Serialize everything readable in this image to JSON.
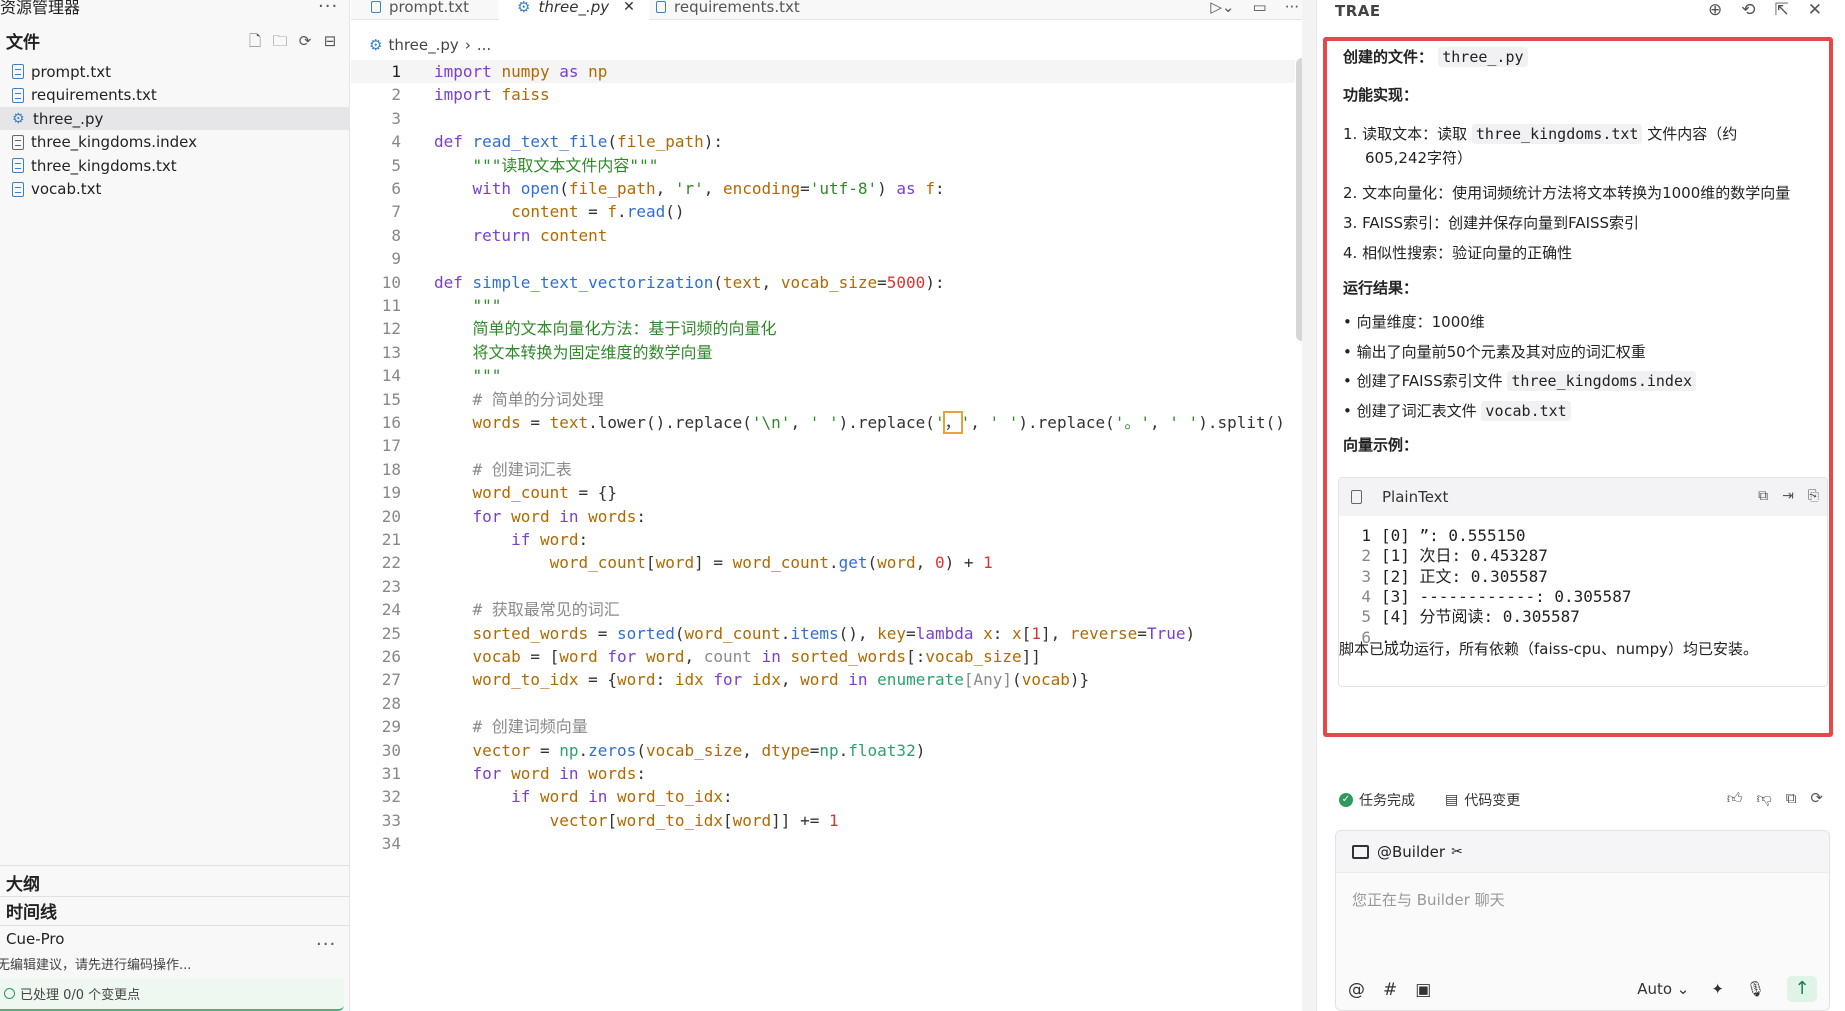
{
  "explorer": {
    "title": "资源管理器",
    "files_section": "文件",
    "files": [
      {
        "name": "prompt.txt",
        "icon": "text-file-icon"
      },
      {
        "name": "requirements.txt",
        "icon": "text-file-icon"
      },
      {
        "name": "three_.py",
        "icon": "python-file-icon"
      },
      {
        "name": "three_kingdoms.index",
        "icon": "generic-file-icon"
      },
      {
        "name": "three_kingdoms.txt",
        "icon": "text-file-icon"
      },
      {
        "name": "vocab.txt",
        "icon": "text-file-icon"
      }
    ],
    "active_file": "three_.py",
    "outline": "大纲",
    "timeline": "时间线",
    "cue_title": "Cue-Pro",
    "cue_message": "暂无编辑建议，请先进行编码操作...",
    "cue_status": "已处理 0/0 个变更点"
  },
  "editor": {
    "tabs": [
      {
        "label": "prompt.txt",
        "active": false
      },
      {
        "label": "three_.py",
        "active": true
      },
      {
        "label": "requirements.txt",
        "active": false
      }
    ],
    "breadcrumb": {
      "file": "three_.py",
      "rest": "..."
    },
    "lines": [
      {
        "n": "1"
      },
      {
        "n": "2"
      },
      {
        "n": "3"
      },
      {
        "n": "4"
      },
      {
        "n": "5"
      },
      {
        "n": "6"
      },
      {
        "n": "7"
      },
      {
        "n": "8"
      },
      {
        "n": "9"
      },
      {
        "n": "10"
      },
      {
        "n": "11"
      },
      {
        "n": "12"
      },
      {
        "n": "13"
      },
      {
        "n": "14"
      },
      {
        "n": "15"
      },
      {
        "n": "16"
      },
      {
        "n": "17"
      },
      {
        "n": "18"
      },
      {
        "n": "19"
      },
      {
        "n": "20"
      },
      {
        "n": "21"
      },
      {
        "n": "22"
      },
      {
        "n": "23"
      },
      {
        "n": "24"
      },
      {
        "n": "25"
      },
      {
        "n": "26"
      },
      {
        "n": "27"
      },
      {
        "n": "28"
      },
      {
        "n": "29"
      },
      {
        "n": "30"
      },
      {
        "n": "31"
      },
      {
        "n": "32"
      },
      {
        "n": "33"
      },
      {
        "n": "34"
      }
    ],
    "code": [
      [
        [
          "kw",
          "import"
        ],
        [
          "id",
          " "
        ],
        [
          "var",
          "numpy"
        ],
        [
          "id",
          " "
        ],
        [
          "kw",
          "as"
        ],
        [
          "id",
          " "
        ],
        [
          "var",
          "np"
        ]
      ],
      [
        [
          "kw",
          "import"
        ],
        [
          "id",
          " "
        ],
        [
          "var",
          "faiss"
        ]
      ],
      [],
      [
        [
          "kw",
          "def"
        ],
        [
          "id",
          " "
        ],
        [
          "fn",
          "read_text_file"
        ],
        [
          "id",
          "("
        ],
        [
          "var",
          "file_path"
        ],
        [
          "id",
          "):"
        ]
      ],
      [
        [
          "id",
          "    "
        ],
        [
          "str",
          "\"\"\"读取文本文件内容\"\"\""
        ]
      ],
      [
        [
          "id",
          "    "
        ],
        [
          "kw",
          "with"
        ],
        [
          "id",
          " "
        ],
        [
          "fn",
          "open"
        ],
        [
          "id",
          "("
        ],
        [
          "var",
          "file_path"
        ],
        [
          "id",
          ", "
        ],
        [
          "str",
          "'r'"
        ],
        [
          "id",
          ", "
        ],
        [
          "var",
          "encoding"
        ],
        [
          "id",
          "="
        ],
        [
          "str",
          "'utf-8'"
        ],
        [
          "id",
          ") "
        ],
        [
          "kw",
          "as"
        ],
        [
          "id",
          " "
        ],
        [
          "var",
          "f"
        ],
        [
          "id",
          ":"
        ]
      ],
      [
        [
          "id",
          "        "
        ],
        [
          "var",
          "content"
        ],
        [
          "id",
          " = "
        ],
        [
          "var",
          "f"
        ],
        [
          "id",
          "."
        ],
        [
          "fn",
          "read"
        ],
        [
          "id",
          "()"
        ]
      ],
      [
        [
          "id",
          "    "
        ],
        [
          "kw",
          "return"
        ],
        [
          "id",
          " "
        ],
        [
          "var",
          "content"
        ]
      ],
      [],
      [
        [
          "kw",
          "def"
        ],
        [
          "id",
          " "
        ],
        [
          "fn",
          "simple_text_vectorization"
        ],
        [
          "id",
          "("
        ],
        [
          "var",
          "text"
        ],
        [
          "id",
          ", "
        ],
        [
          "var",
          "vocab_size"
        ],
        [
          "id",
          "="
        ],
        [
          "num",
          "5000"
        ],
        [
          "id",
          "):"
        ]
      ],
      [
        [
          "id",
          "    "
        ],
        [
          "str",
          "\"\"\""
        ]
      ],
      [
        [
          "id",
          "    "
        ],
        [
          "str",
          "简单的文本向量化方法：基于词频的向量化"
        ]
      ],
      [
        [
          "id",
          "    "
        ],
        [
          "str",
          "将文本转换为固定维度的数学向量"
        ]
      ],
      [
        [
          "id",
          "    "
        ],
        [
          "str",
          "\"\"\""
        ]
      ],
      [
        [
          "id",
          "    "
        ],
        [
          "cm",
          "# 简单的分词处理"
        ]
      ],
      [
        [
          "id",
          "    "
        ],
        [
          "var",
          "words"
        ],
        [
          "id",
          " = "
        ],
        [
          "var",
          "text"
        ],
        [
          "id",
          ".lower().replace("
        ],
        [
          "str",
          "'\\n'"
        ],
        [
          "id",
          ", "
        ],
        [
          "str",
          "' '"
        ],
        [
          "id",
          ").replace("
        ],
        [
          "str",
          "'"
        ],
        [
          "hl",
          "，"
        ],
        [
          "str",
          "'"
        ],
        [
          "id",
          ", "
        ],
        [
          "str",
          "' '"
        ],
        [
          "id",
          ").replace("
        ],
        [
          "str",
          "'。'"
        ],
        [
          "id",
          ", "
        ],
        [
          "str",
          "' '"
        ],
        [
          "id",
          ").split()"
        ]
      ],
      [],
      [
        [
          "id",
          "    "
        ],
        [
          "cm",
          "# 创建词汇表"
        ]
      ],
      [
        [
          "id",
          "    "
        ],
        [
          "var",
          "word_count"
        ],
        [
          "id",
          " = {}"
        ]
      ],
      [
        [
          "id",
          "    "
        ],
        [
          "kw",
          "for"
        ],
        [
          "id",
          " "
        ],
        [
          "var",
          "word"
        ],
        [
          "id",
          " "
        ],
        [
          "kw",
          "in"
        ],
        [
          "id",
          " "
        ],
        [
          "var",
          "words"
        ],
        [
          "id",
          ":"
        ]
      ],
      [
        [
          "id",
          "        "
        ],
        [
          "kw",
          "if"
        ],
        [
          "id",
          " "
        ],
        [
          "var",
          "word"
        ],
        [
          "id",
          ":"
        ]
      ],
      [
        [
          "id",
          "            "
        ],
        [
          "var",
          "word_count"
        ],
        [
          "id",
          "["
        ],
        [
          "var",
          "word"
        ],
        [
          "id",
          "] = "
        ],
        [
          "var",
          "word_count"
        ],
        [
          "id",
          "."
        ],
        [
          "fn",
          "get"
        ],
        [
          "id",
          "("
        ],
        [
          "var",
          "word"
        ],
        [
          "id",
          ", "
        ],
        [
          "num",
          "0"
        ],
        [
          "id",
          ") + "
        ],
        [
          "num",
          "1"
        ]
      ],
      [],
      [
        [
          "id",
          "    "
        ],
        [
          "cm",
          "# 获取最常见的词汇"
        ]
      ],
      [
        [
          "id",
          "    "
        ],
        [
          "var",
          "sorted_words"
        ],
        [
          "id",
          " = "
        ],
        [
          "fn",
          "sorted"
        ],
        [
          "id",
          "("
        ],
        [
          "var",
          "word_count"
        ],
        [
          "id",
          "."
        ],
        [
          "fn",
          "items"
        ],
        [
          "id",
          "(), "
        ],
        [
          "var",
          "key"
        ],
        [
          "id",
          "="
        ],
        [
          "kw",
          "lambda"
        ],
        [
          "id",
          " "
        ],
        [
          "var",
          "x"
        ],
        [
          "id",
          ": "
        ],
        [
          "var",
          "x"
        ],
        [
          "id",
          "["
        ],
        [
          "num",
          "1"
        ],
        [
          "id",
          "], "
        ],
        [
          "var",
          "reverse"
        ],
        [
          "id",
          "="
        ],
        [
          "kw",
          "True"
        ],
        [
          "id",
          ")"
        ]
      ],
      [
        [
          "id",
          "    "
        ],
        [
          "var",
          "vocab"
        ],
        [
          "id",
          " = ["
        ],
        [
          "var",
          "word"
        ],
        [
          "id",
          " "
        ],
        [
          "kw",
          "for"
        ],
        [
          "id",
          " "
        ],
        [
          "var",
          "word"
        ],
        [
          "id",
          ", "
        ],
        [
          "cm",
          "count"
        ],
        [
          "id",
          " "
        ],
        [
          "kw",
          "in"
        ],
        [
          "id",
          " "
        ],
        [
          "var",
          "sorted_words"
        ],
        [
          "id",
          "[:"
        ],
        [
          "var",
          "vocab_size"
        ],
        [
          "id",
          "]]"
        ]
      ],
      [
        [
          "id",
          "    "
        ],
        [
          "var",
          "word_to_idx"
        ],
        [
          "id",
          " = {"
        ],
        [
          "var",
          "word"
        ],
        [
          "id",
          ": "
        ],
        [
          "var",
          "idx"
        ],
        [
          "id",
          " "
        ],
        [
          "kw",
          "for"
        ],
        [
          "id",
          " "
        ],
        [
          "var",
          "idx"
        ],
        [
          "id",
          ", "
        ],
        [
          "var",
          "word"
        ],
        [
          "id",
          " "
        ],
        [
          "kw",
          "in"
        ],
        [
          "id",
          " "
        ],
        [
          "cn",
          "enumerate"
        ],
        [
          "cm",
          "[Any]"
        ],
        [
          "id",
          "("
        ],
        [
          "var",
          "vocab"
        ],
        [
          "id",
          ")}"
        ]
      ],
      [],
      [
        [
          "id",
          "    "
        ],
        [
          "cm",
          "# 创建词频向量"
        ]
      ],
      [
        [
          "id",
          "    "
        ],
        [
          "var",
          "vector"
        ],
        [
          "id",
          " = "
        ],
        [
          "cn",
          "np"
        ],
        [
          "id",
          "."
        ],
        [
          "fn",
          "zeros"
        ],
        [
          "id",
          "("
        ],
        [
          "var",
          "vocab_size"
        ],
        [
          "id",
          ", "
        ],
        [
          "var",
          "dtype"
        ],
        [
          "id",
          "="
        ],
        [
          "cn",
          "np"
        ],
        [
          "id",
          "."
        ],
        [
          "cn",
          "float32"
        ],
        [
          "id",
          ")"
        ]
      ],
      [
        [
          "id",
          "    "
        ],
        [
          "kw",
          "for"
        ],
        [
          "id",
          " "
        ],
        [
          "var",
          "word"
        ],
        [
          "id",
          " "
        ],
        [
          "kw",
          "in"
        ],
        [
          "id",
          " "
        ],
        [
          "var",
          "words"
        ],
        [
          "id",
          ":"
        ]
      ],
      [
        [
          "id",
          "        "
        ],
        [
          "kw",
          "if"
        ],
        [
          "id",
          " "
        ],
        [
          "var",
          "word"
        ],
        [
          "id",
          " "
        ],
        [
          "kw",
          "in"
        ],
        [
          "id",
          " "
        ],
        [
          "var",
          "word_to_idx"
        ],
        [
          "id",
          ":"
        ]
      ],
      [
        [
          "id",
          "            "
        ],
        [
          "var",
          "vector"
        ],
        [
          "id",
          "["
        ],
        [
          "var",
          "word_to_idx"
        ],
        [
          "id",
          "["
        ],
        [
          "var",
          "word"
        ],
        [
          "id",
          "]] += "
        ],
        [
          "num",
          "1"
        ]
      ],
      []
    ]
  },
  "chat": {
    "brand": "TRAE",
    "created_label": "创建的文件：",
    "created_file": "three_.py",
    "features_title": "功能实现：",
    "features": [
      {
        "idx": "1.",
        "pre": "读取文本：读取",
        "chip": "three_kingdoms.txt",
        "post": "文件内容（约",
        "cont": "605,242字符）"
      },
      {
        "idx": "2.",
        "pre": "文本向量化：使用词频统计方法将文本转换为1000维的数学向量",
        "chip": "",
        "post": "",
        "cont": ""
      },
      {
        "idx": "3.",
        "pre": "FAISS索引：创建并保存向量到FAISS索引",
        "chip": "",
        "post": "",
        "cont": ""
      },
      {
        "idx": "4.",
        "pre": "相似性搜索：验证向量的正确性",
        "chip": "",
        "post": "",
        "cont": ""
      }
    ],
    "results_title": "运行结果：",
    "results": [
      {
        "pre": "向量维度：1000维",
        "chip": ""
      },
      {
        "pre": "输出了向量前50个元素及其对应的词汇权重",
        "chip": ""
      },
      {
        "pre": "创建了FAISS索引文件",
        "chip": "three_kingdoms.index"
      },
      {
        "pre": "创建了词汇表文件",
        "chip": "vocab.txt"
      }
    ],
    "example_title": "向量示例：",
    "code_card": {
      "lang": "PlainText",
      "lines": [
        {
          "n": "1",
          "text": "[0] ”: 0.555150"
        },
        {
          "n": "2",
          "text": "[1] 次日: 0.453287"
        },
        {
          "n": "3",
          "text": "[2] 正文: 0.305587"
        },
        {
          "n": "4",
          "text": "[3] ------------: 0.305587"
        },
        {
          "n": "5",
          "text": "[4] 分节阅读: 0.305587"
        },
        {
          "n": "6",
          "text": "..."
        }
      ]
    },
    "summary": "脚本已成功运行，所有依赖（faiss-cpu、numpy）均已安装。",
    "task_done": "任务完成",
    "code_change": "代码变更",
    "builder_label": "@Builder",
    "input_placeholder": "您正在与 Builder 聊天",
    "model": "Auto"
  }
}
